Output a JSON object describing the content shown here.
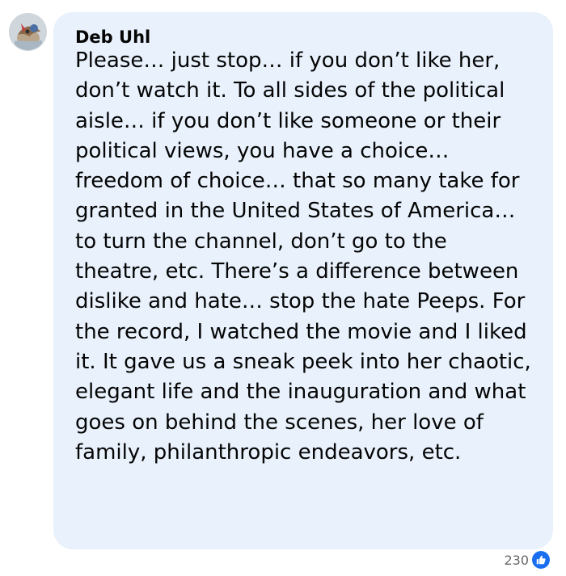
{
  "comment": {
    "author": "Deb Uhl",
    "text": "Please… just stop… if you don’t like her, don’t watch it. To all sides of the political aisle… if you don’t like someone or their political views, you have a choice… freedom of choice… that so many take for granted in the United States of America… to turn the channel, don’t go to the theatre, etc. There’s a difference between dislike and hate… stop the hate Peeps. For the record, I watched the movie and I liked it. It gave us a sneak peek into her chaotic, elegant life and the inauguration and what goes on behind the scenes, her love of family, philanthropic endeavors, etc.",
    "reaction_count": "230",
    "reaction_icon": "thumbs-up-icon"
  },
  "colors": {
    "bubble_background": "#e8f1fc",
    "text": "#050505",
    "muted_text": "#65676b",
    "like_blue": "#1a6ff0"
  }
}
